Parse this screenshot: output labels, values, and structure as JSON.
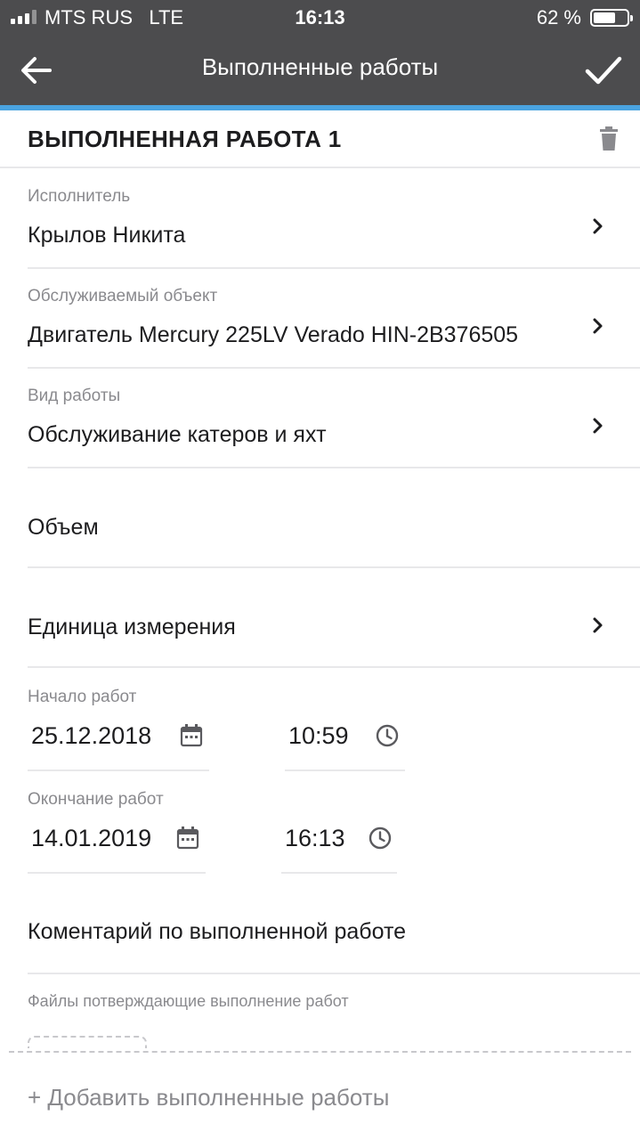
{
  "status_bar": {
    "carrier": "MTS RUS",
    "network": "LTE",
    "time": "16:13",
    "battery": "62 %"
  },
  "nav": {
    "title": "Выполненные работы",
    "back_icon": "arrow-left-icon",
    "confirm_icon": "checkmark-icon"
  },
  "section": {
    "title": "ВЫПОЛНЕННАЯ РАБОТА 1",
    "delete_icon": "trash-icon"
  },
  "fields": {
    "performer": {
      "label": "Исполнитель",
      "value": "Крылов Никита"
    },
    "object": {
      "label": "Обслуживаемый объект",
      "value": "Двигатель Mercury 225LV Verado HIN-2B376505"
    },
    "work_type": {
      "label": "Вид работы",
      "value": "Обслуживание катеров и яхт"
    },
    "volume": {
      "placeholder": "Объем"
    },
    "unit": {
      "placeholder": "Единица измерения"
    }
  },
  "start": {
    "label": "Начало работ",
    "date": "25.12.2018",
    "time": "10:59"
  },
  "end": {
    "label": "Окончание работ",
    "date": "14.01.2019",
    "time": "16:13"
  },
  "comment": {
    "placeholder": "Коментарий по выполненной работе"
  },
  "files": {
    "label": "Файлы потверждающие выполнение работ"
  },
  "add_button": {
    "label": "+ Добавить выполненные работы"
  },
  "colors": {
    "nav_bg": "#4c4c4e",
    "accent": "#4aa3df",
    "label_gray": "#8a8a8e"
  }
}
